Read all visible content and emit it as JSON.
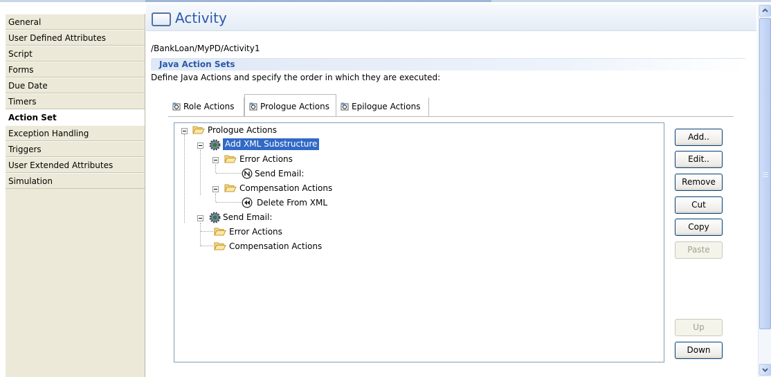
{
  "nav": {
    "items": [
      {
        "label": "General",
        "active": false
      },
      {
        "label": "User Defined Attributes",
        "active": false
      },
      {
        "label": "Script",
        "active": false
      },
      {
        "label": "Forms",
        "active": false
      },
      {
        "label": "Due Date",
        "active": false
      },
      {
        "label": "Timers",
        "active": false
      },
      {
        "label": "Action Set",
        "active": true
      },
      {
        "label": "Exception Handling",
        "active": false
      },
      {
        "label": "Triggers",
        "active": false
      },
      {
        "label": "User Extended Attributes",
        "active": false
      },
      {
        "label": "Simulation",
        "active": false
      }
    ]
  },
  "header": {
    "title": "Activity",
    "icon": "activity-box-icon"
  },
  "path": "/BankLoan/MyPD/Activity1",
  "section": {
    "title": "Java Action Sets",
    "description": "Define Java Actions and specify the order in which they are executed:"
  },
  "tabs": [
    {
      "label": "Role Actions",
      "icon": "java-action-icon",
      "selected": false
    },
    {
      "label": "Prologue Actions",
      "icon": "java-action-icon",
      "selected": true
    },
    {
      "label": "Epilogue Actions",
      "icon": "java-action-icon",
      "selected": false
    }
  ],
  "tree": {
    "root": "Prologue Actions",
    "nodes": [
      {
        "label": "Add XML Substructure",
        "icon": "gear-icon",
        "selected": true
      },
      {
        "label": "Error Actions",
        "icon": "folder-icon"
      },
      {
        "label": "Send Email:",
        "icon": "n-circle-icon"
      },
      {
        "label": "Compensation Actions",
        "icon": "folder-icon"
      },
      {
        "label": "Delete From XML",
        "icon": "rewind-circle-icon"
      },
      {
        "label": "Send Email:",
        "icon": "gear-icon"
      },
      {
        "label": "Error Actions",
        "icon": "folder-icon"
      },
      {
        "label": "Compensation Actions",
        "icon": "folder-icon"
      }
    ]
  },
  "buttons": {
    "add": "Add..",
    "edit": "Edit..",
    "remove": "Remove",
    "cut": "Cut",
    "copy": "Copy",
    "paste": "Paste",
    "up": "Up",
    "down": "Down"
  },
  "colors": {
    "accent": "#2b59a8",
    "selection": "#3169c6",
    "nav_bg": "#ece9d8"
  }
}
